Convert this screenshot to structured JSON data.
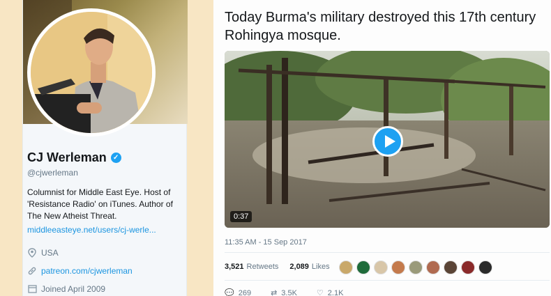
{
  "profile": {
    "name": "CJ Werleman",
    "handle": "@cjwerleman",
    "bio": "Columnist for Middle East Eye. Host of 'Resistance Radio' on iTunes. Author of The New Atheist Threat.",
    "link": "middleeasteye.net/users/cj-werle...",
    "location": "USA",
    "website": "patreon.com/cjwerleman",
    "joined": "Joined April 2009",
    "verified_icon": "verified-check-icon"
  },
  "tweet": {
    "text": "Today Burma's military destroyed this 17th century Rohingya mosque.",
    "video": {
      "duration": "0:37",
      "play_icon": "play-icon"
    },
    "timestamp": "11:35 AM - 15 Sep 2017",
    "retweets_count": "3,521",
    "retweets_label": "Retweets",
    "likes_count": "2,089",
    "likes_label": "Likes",
    "actions": {
      "reply": "269",
      "retweet": "3.5K",
      "like": "2.1K"
    }
  },
  "colors": {
    "accent": "#1da1f2",
    "link": "#1b95e0",
    "muted": "#657786"
  }
}
